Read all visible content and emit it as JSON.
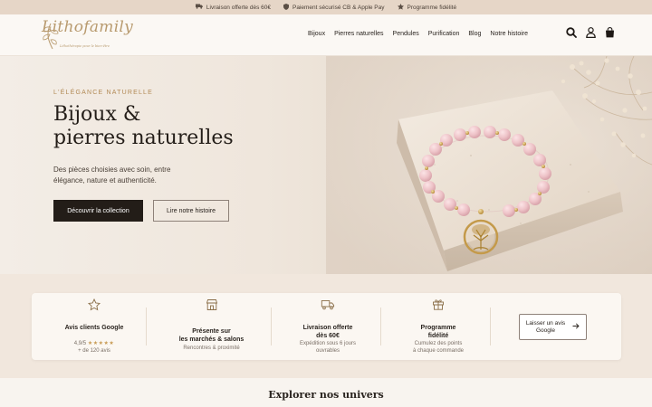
{
  "topbar": {
    "items": [
      {
        "icon": "truck-icon",
        "label": "Livraison offerte dès 60€"
      },
      {
        "icon": "shield-icon",
        "label": "Paiement sécurisé CB & Apple Pay"
      },
      {
        "icon": "star-icon",
        "label": "Programme fidélité"
      }
    ]
  },
  "header": {
    "logo": "Lithofamily",
    "logo_tagline": "Lithothérapie pour le bien-être",
    "nav": [
      "Bijoux",
      "Pierres naturelles",
      "Pendules",
      "Purification",
      "Blog",
      "Notre histoire"
    ],
    "icons": [
      "search-icon",
      "user-icon",
      "bag-icon"
    ]
  },
  "hero": {
    "eyebrow": "L'ÉLÉGANCE NATURELLE",
    "title_line1": "Bijoux &",
    "title_line2": "pierres naturelles",
    "subtitle": "Des pièces choisies avec soin, entre élégance, nature et authenticité.",
    "primary_cta": "Découvrir la collection",
    "secondary_cta": "Lire notre histoire"
  },
  "features": [
    {
      "icon": "star-outline-icon",
      "title": "Avis clients Google",
      "rating": "4,9/5",
      "stars": "★★★★★",
      "sub": "+ de 120 avis"
    },
    {
      "icon": "store-icon",
      "title_line1": "Présente sur",
      "title_line2": "les marchés & salons",
      "sub": "Rencontres & proximité"
    },
    {
      "icon": "truck-outline-icon",
      "title_line1": "Livraison offerte",
      "title_line2": "dès 60€",
      "sub_line1": "Expédition sous 6 jours",
      "sub_line2": "ouvrables"
    },
    {
      "icon": "gift-icon",
      "title_line1": "Programme",
      "title_line2": "fidélité",
      "sub_line1": "Cumulez des points",
      "sub_line2": "à chaque commande"
    }
  ],
  "review_button": {
    "line1": "Laisser un avis",
    "line2": "Google"
  },
  "explore": {
    "title": "Explorer nos univers"
  }
}
